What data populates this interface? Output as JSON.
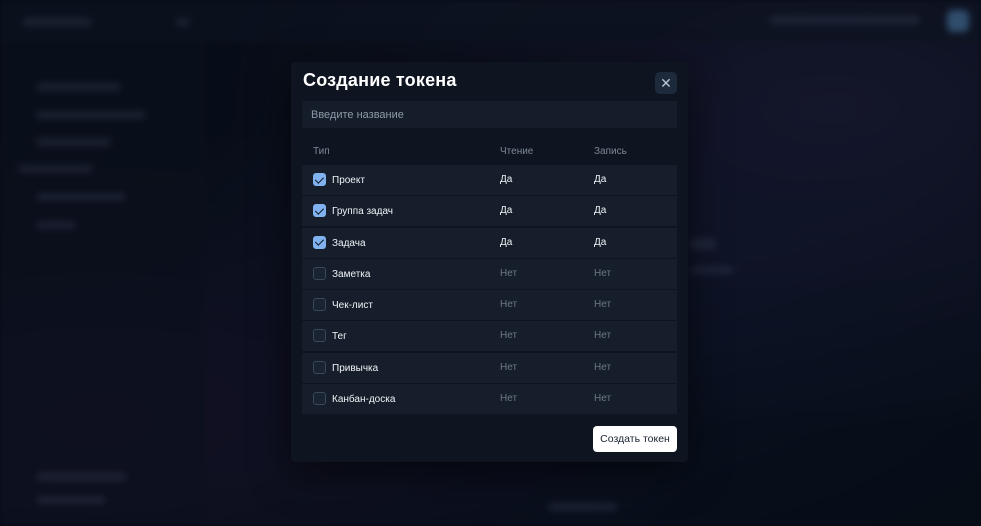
{
  "modal": {
    "title": "Создание токена",
    "close_icon": "close-icon",
    "name_placeholder": "Введите название",
    "create_button": "Создать токен"
  },
  "table": {
    "headers": {
      "type": "Тип",
      "read": "Чтение",
      "write": "Запись"
    },
    "rows": [
      {
        "label": "Проект",
        "checked": true,
        "read": "Да",
        "write": "Да"
      },
      {
        "label": "Группа задач",
        "checked": true,
        "read": "Да",
        "write": "Да"
      },
      {
        "label": "Задача",
        "checked": true,
        "read": "Да",
        "write": "Да"
      },
      {
        "label": "Заметка",
        "checked": false,
        "read": "Нет",
        "write": "Нет"
      },
      {
        "label": "Чек-лист",
        "checked": false,
        "read": "Нет",
        "write": "Нет"
      },
      {
        "label": "Тег",
        "checked": false,
        "read": "Нет",
        "write": "Нет"
      },
      {
        "label": "Привычка",
        "checked": false,
        "read": "Нет",
        "write": "Нет"
      },
      {
        "label": "Канбан-доска",
        "checked": false,
        "read": "Нет",
        "write": "Нет"
      }
    ]
  },
  "colors": {
    "accent": "#7fb2ef",
    "modal_bg": "#0e1520",
    "row_bg": "#151e2a"
  }
}
